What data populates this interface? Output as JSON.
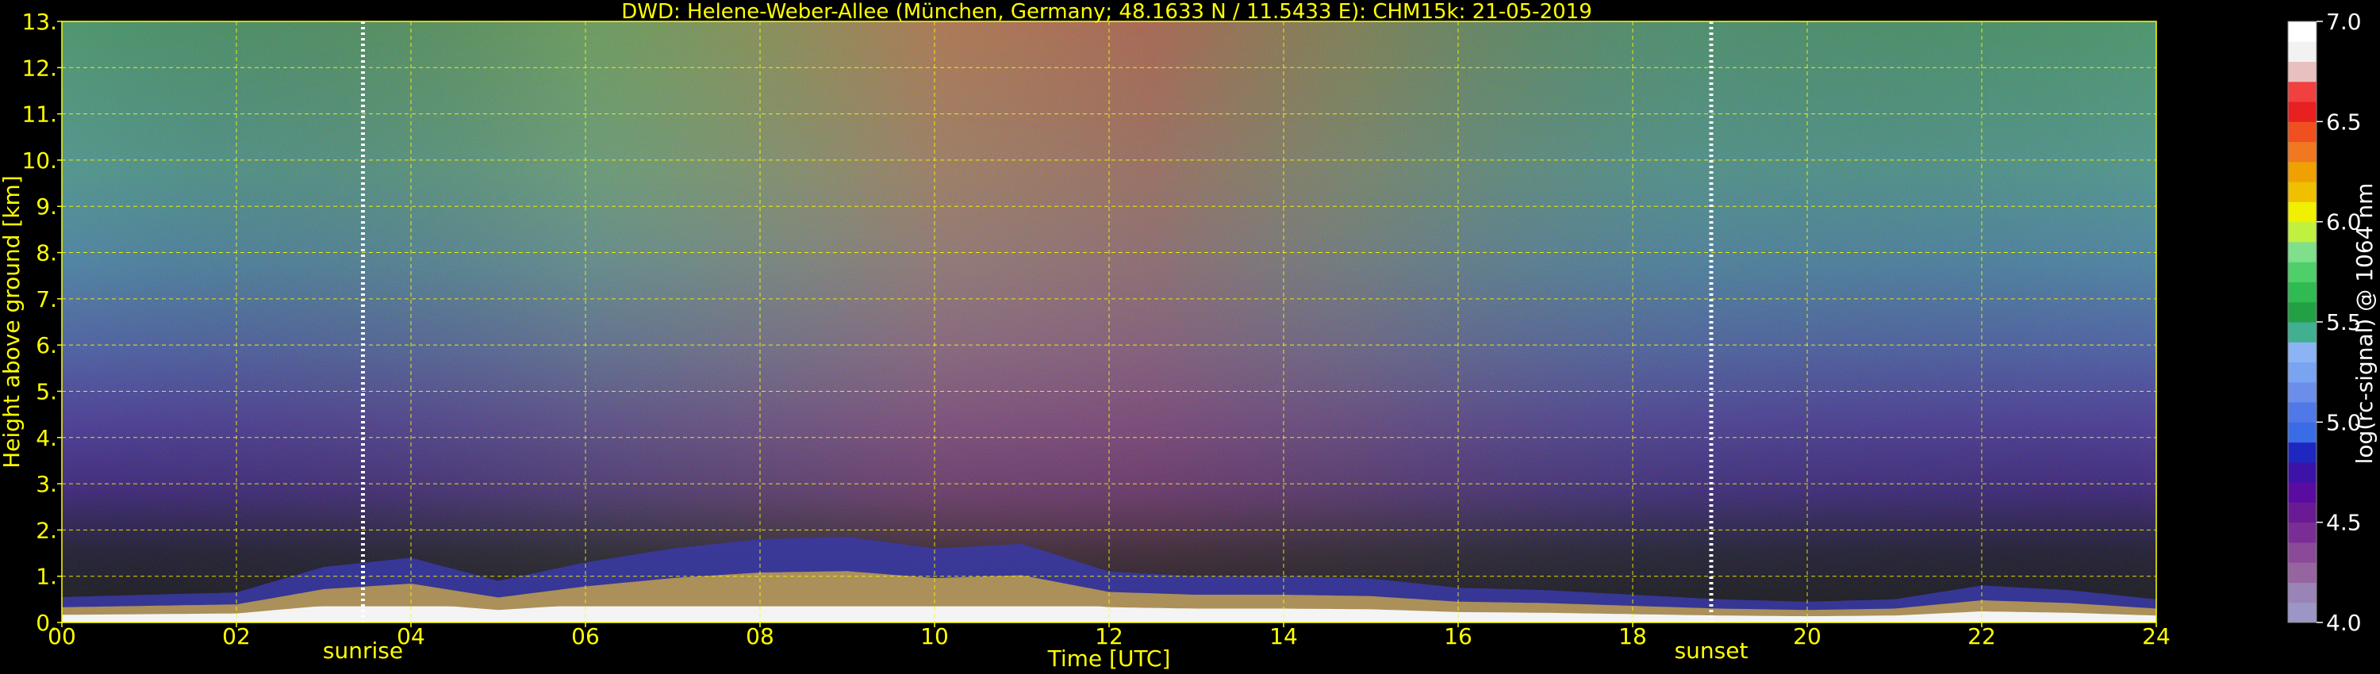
{
  "chart_data": {
    "type": "heatmap",
    "title": "DWD: Helene-Weber-Allee (München, Germany; 48.1633 N / 11.5433 E):    CHM15k: 21-05-2019",
    "xlabel": "Time [UTC]",
    "ylabel": "Height above ground [km]",
    "xlim": [
      0,
      24
    ],
    "ylim": [
      0,
      13
    ],
    "x_ticks": [
      "00",
      "02",
      "04",
      "06",
      "08",
      "10",
      "12",
      "14",
      "16",
      "18",
      "20",
      "22",
      "24"
    ],
    "y_ticks": [
      "0.",
      "1.",
      "2.",
      "3.",
      "4.",
      "5.",
      "6.",
      "7.",
      "8.",
      "9.",
      "10.",
      "11.",
      "12.",
      "13."
    ],
    "grid": true,
    "markers": [
      {
        "label": "sunrise",
        "x": 3.45
      },
      {
        "label": "sunset",
        "x": 18.9
      }
    ],
    "colorbar": {
      "label": "log(rc-signal) @ 1064 nm",
      "range": [
        4.0,
        7.0
      ],
      "ticks": [
        "4.0",
        "4.5",
        "5.0",
        "5.5",
        "6.0",
        "6.5",
        "7.0"
      ],
      "colors": [
        "#9b96c6",
        "#9a83b6",
        "#96649e",
        "#8a4a98",
        "#7a2d94",
        "#6a1a94",
        "#5a0ca0",
        "#3c12a8",
        "#1e28c0",
        "#3a6ce6",
        "#5078e6",
        "#6a8eea",
        "#7aa4f0",
        "#8cb4f4",
        "#40b090",
        "#22a044",
        "#2fbb52",
        "#4fcf6a",
        "#7fdf8a",
        "#c0f040",
        "#f0f000",
        "#f0c000",
        "#f0a000",
        "#f07820",
        "#f05020",
        "#e82020",
        "#f04040",
        "#e8c0c0",
        "#f2f2f2",
        "#ffffff"
      ]
    },
    "aerosol_layer_top_km": [
      [
        0,
        0.55
      ],
      [
        1,
        0.6
      ],
      [
        2,
        0.65
      ],
      [
        3,
        1.2
      ],
      [
        4,
        1.4
      ],
      [
        5,
        0.9
      ],
      [
        6,
        1.3
      ],
      [
        7,
        1.6
      ],
      [
        8,
        1.8
      ],
      [
        9,
        1.85
      ],
      [
        10,
        1.6
      ],
      [
        11,
        1.7
      ],
      [
        12,
        1.1
      ],
      [
        13,
        1.0
      ],
      [
        14,
        1.0
      ],
      [
        15,
        0.95
      ],
      [
        16,
        0.75
      ],
      [
        17,
        0.7
      ],
      [
        18,
        0.6
      ],
      [
        19,
        0.5
      ],
      [
        20,
        0.45
      ],
      [
        21,
        0.5
      ],
      [
        22,
        0.8
      ],
      [
        23,
        0.7
      ],
      [
        24,
        0.5
      ]
    ]
  }
}
